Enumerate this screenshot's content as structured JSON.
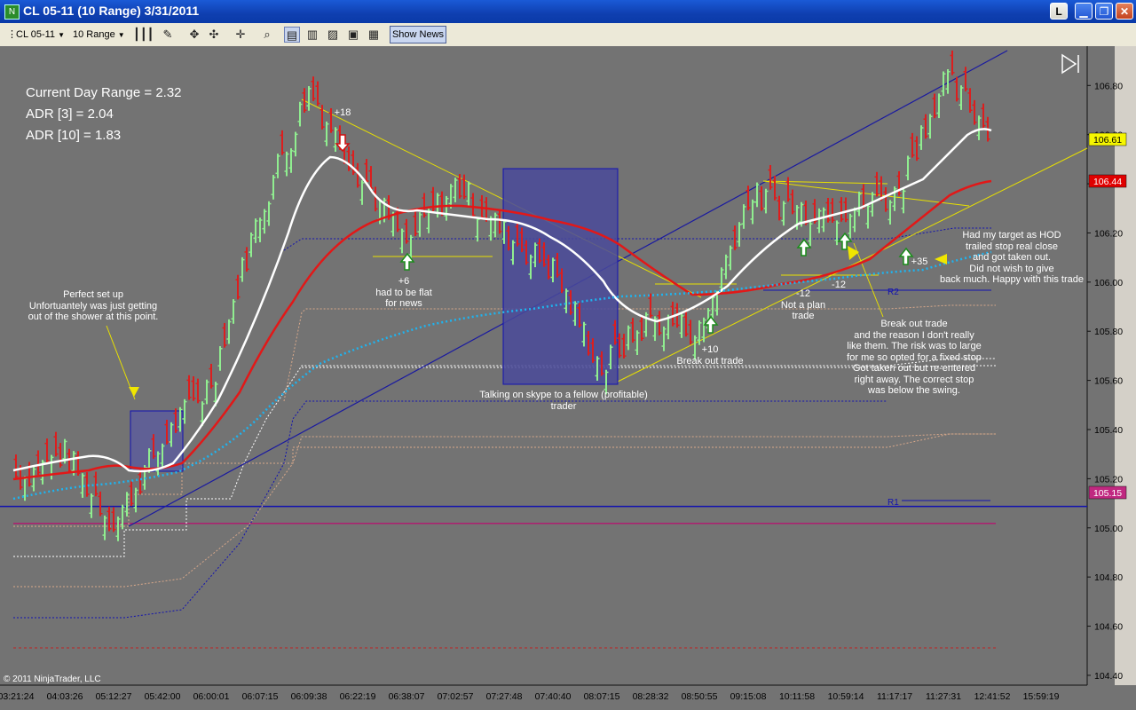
{
  "window": {
    "title": "CL 05-11 (10 Range)  3/31/2011",
    "btn_l": "L",
    "btn_min": "▁",
    "btn_max": "❐",
    "btn_close": "✕"
  },
  "toolbar": {
    "instrument": "CL 05-11",
    "period": "10 Range",
    "show_news": "Show News"
  },
  "info": {
    "line1": "Current Day Range = 2.32",
    "line2": "ADR [3] = 2.04",
    "line3": "ADR [10] = 1.83"
  },
  "copyright": "© 2011 NinjaTrader, LLC",
  "price_tags": {
    "last": "106.61",
    "ma": "106.44",
    "r1": "105.15"
  },
  "annotations": {
    "perfect": [
      "Perfect set up",
      "Unfortuantely was just getting",
      "out of the shower at this point."
    ],
    "p18": "+18",
    "p6": [
      "+6",
      "had to be flat",
      "for news"
    ],
    "skype": [
      "Talking on skype to a fellow (profitable)",
      "trader"
    ],
    "p10": [
      "+10",
      "Break out trade"
    ],
    "m12a": [
      "-12",
      "Not a plan",
      "trade"
    ],
    "m12b": "-12",
    "breakout": [
      "Break out trade",
      "and the reason I don't really",
      "like them. The risk was to large",
      "for me so opted for a fixed stop",
      "Got taken out but re-entered",
      "right away. The correct stop",
      "was below the swing."
    ],
    "p35": "+35",
    "hod": [
      "Had my target as HOD",
      "trailed stop real close",
      "and got taken out.",
      "Did not wish to give",
      "back much. Happy with this trade"
    ],
    "r2": "R2",
    "r1": "R1"
  },
  "chart_data": {
    "type": "bar",
    "title": "CL 05-11 (10 Range)  3/31/2011",
    "ylim": [
      104.36,
      106.96
    ],
    "y_ticks": [
      106.8,
      106.6,
      106.4,
      106.2,
      106.0,
      105.8,
      105.6,
      105.4,
      105.2,
      105.0,
      104.8,
      104.6,
      104.4
    ],
    "x_ticks": [
      "03:21:24",
      "04:03:26",
      "05:12:27",
      "05:42:00",
      "06:00:01",
      "06:07:15",
      "06:09:38",
      "06:22:19",
      "06:38:07",
      "07:02:57",
      "07:27:48",
      "07:40:40",
      "08:07:15",
      "08:28:32",
      "08:50:55",
      "09:15:08",
      "10:11:58",
      "10:59:14",
      "11:17:17",
      "11:27:31",
      "12:41:52",
      "15:59:19"
    ],
    "levels": {
      "r1": 105.11,
      "r2": 105.99,
      "pivot_line": 105.15,
      "s_line": 104.51
    },
    "path_points": [
      [
        "03:21:24",
        105.2
      ],
      [
        "04:03:26",
        105.3
      ],
      [
        "05:12:27",
        105.02
      ],
      [
        "05:42:00",
        105.35
      ],
      [
        "06:00:01",
        105.6
      ],
      [
        "06:07:15",
        106.3
      ],
      [
        "06:09:38",
        106.78
      ],
      [
        "06:22:19",
        106.45
      ],
      [
        "06:38:07",
        106.15
      ],
      [
        "07:02:57",
        106.4
      ],
      [
        "07:27:48",
        106.2
      ],
      [
        "07:40:40",
        106.05
      ],
      [
        "08:07:15",
        105.65
      ],
      [
        "08:28:32",
        105.85
      ],
      [
        "08:50:55",
        105.8
      ],
      [
        "09:15:08",
        106.35
      ],
      [
        "10:11:58",
        106.3
      ],
      [
        "10:59:14",
        106.3
      ],
      [
        "11:17:17",
        106.35
      ],
      [
        "11:27:31",
        106.82
      ],
      [
        "12:41:52",
        106.61
      ]
    ]
  },
  "colors": {
    "background": "#737373",
    "up_bar": "#90ee90",
    "down_bar": "#dc1e1e",
    "ema_white": "#ffffff",
    "sma_red": "#e01010",
    "vwap": "#1eb4f0",
    "trend": "#1a1aa0",
    "annot_yellow": "#f0e600"
  }
}
